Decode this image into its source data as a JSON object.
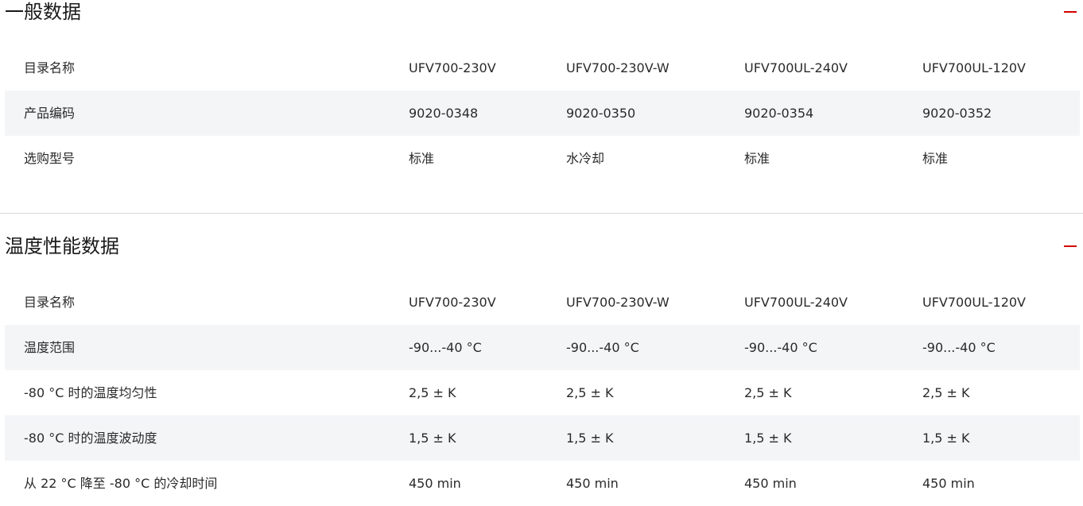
{
  "sections": [
    {
      "title": "一般数据",
      "rows": [
        {
          "label": "目录名称",
          "values": [
            "UFV700-230V",
            "UFV700-230V-W",
            "UFV700UL-240V",
            "UFV700UL-120V"
          ]
        },
        {
          "label": "产品编码",
          "values": [
            "9020-0348",
            "9020-0350",
            "9020-0354",
            "9020-0352"
          ]
        },
        {
          "label": "选购型号",
          "values": [
            "标准",
            "水冷却",
            "标准",
            "标准"
          ]
        }
      ]
    },
    {
      "title": "温度性能数据",
      "rows": [
        {
          "label": "目录名称",
          "values": [
            "UFV700-230V",
            "UFV700-230V-W",
            "UFV700UL-240V",
            "UFV700UL-120V"
          ]
        },
        {
          "label": "温度范围",
          "values": [
            "-90...-40 °C",
            "-90...-40 °C",
            "-90...-40 °C",
            "-90...-40 °C"
          ]
        },
        {
          "label": "-80 °C 时的温度均匀性",
          "values": [
            "2,5 ± K",
            "2,5 ± K",
            "2,5 ± K",
            "2,5 ± K"
          ]
        },
        {
          "label": "-80 °C 时的温度波动度",
          "values": [
            "1,5 ± K",
            "1,5 ± K",
            "1,5 ± K",
            "1,5 ± K"
          ]
        },
        {
          "label": "从 22 °C 降至 -80 °C 的冷却时间",
          "values": [
            "450 min",
            "450 min",
            "450 min",
            "450 min"
          ]
        }
      ]
    }
  ],
  "colors": {
    "accent": "#d40000",
    "row_alt": "#f4f5f7",
    "divider": "#d9d9d9"
  },
  "icons": {
    "collapse": "minus-icon"
  }
}
